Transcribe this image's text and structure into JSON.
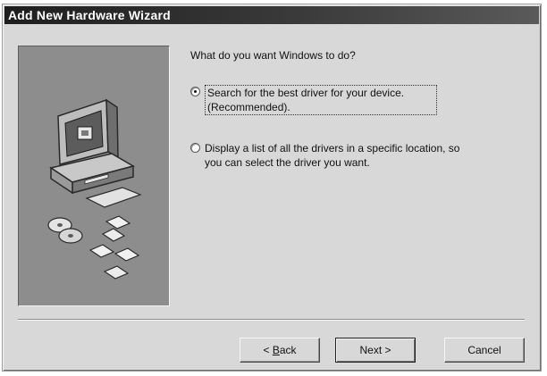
{
  "window": {
    "title": "Add New Hardware Wizard",
    "title_bar_color": "#1e1e1e",
    "face_color": "#d8d8d8",
    "art_panel_color": "#8d8d8d"
  },
  "content": {
    "question": "What do you want Windows to do?",
    "options": [
      {
        "label_line1": "Search for the best driver for your device.",
        "label_line2": "(Recommended).",
        "selected": true
      },
      {
        "label_line1": "Display a list of all the drivers in a specific location, so",
        "label_line2": "you can select the driver you want.",
        "selected": false
      }
    ]
  },
  "buttons": {
    "back_prefix": "< ",
    "back_key": "B",
    "back_rest": "ack",
    "next_label": "Next >",
    "cancel_label": "Cancel"
  },
  "art": {
    "icons": [
      "computer-icon",
      "cd-disc-icon",
      "floppy-disk-icon"
    ]
  }
}
